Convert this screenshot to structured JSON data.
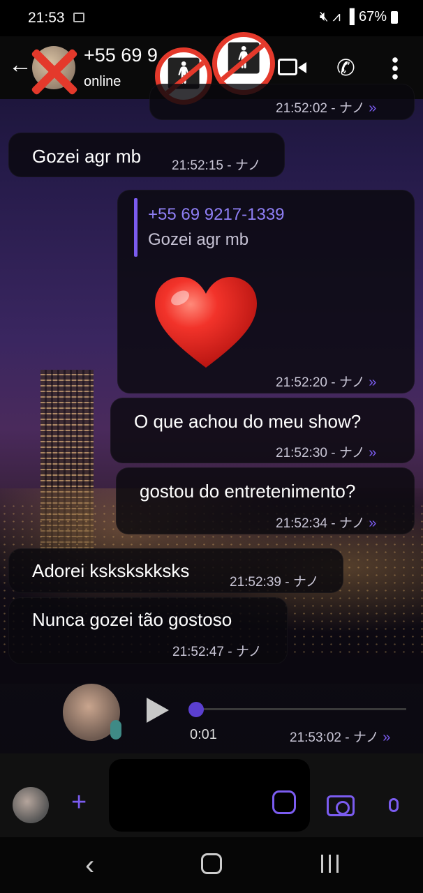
{
  "status_bar": {
    "time": "21:53",
    "battery": "67%"
  },
  "header": {
    "contact_name": "+55 69 9",
    "contact_status": "online",
    "icons": [
      "back-arrow-icon",
      "video-call-icon",
      "phone-icon",
      "more-icon"
    ]
  },
  "messages": [
    {
      "direction": "out",
      "text": "",
      "time": "21:52:02 - ナノ"
    },
    {
      "direction": "in",
      "text": "Gozei agr mb",
      "time": "21:52:15 - ナノ"
    },
    {
      "direction": "out",
      "quote": {
        "name": "+55 69 9217-1339",
        "text": "Gozei agr mb"
      },
      "text": "❤️",
      "time": "21:52:20 - ナノ"
    },
    {
      "direction": "out",
      "text": "O que achou do meu show?",
      "time": "21:52:30 - ナノ"
    },
    {
      "direction": "out",
      "text": "gostou do entretenimento?",
      "time": "21:52:34 - ナノ"
    },
    {
      "direction": "in",
      "text": "Adorei ksksksk​ksks",
      "time": "21:52:39 - ナノ"
    },
    {
      "direction": "in",
      "text": "Nunca gozei tão gostoso",
      "time": "21:52:47 - ナノ"
    }
  ],
  "voice_message": {
    "duration": "0:01",
    "time": "21:53:02 - ナノ",
    "progress": 0
  },
  "seen_mark": "»",
  "colors": {
    "accent": "#7b5cf0",
    "bubble": "#0a080e",
    "header": "#0a0a0a"
  }
}
